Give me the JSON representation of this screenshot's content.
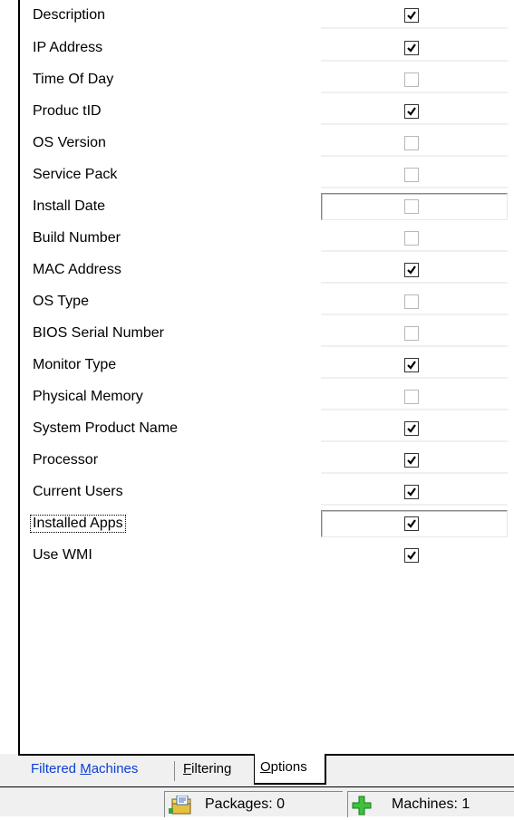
{
  "options": {
    "rows": [
      {
        "label": "Description",
        "checked": true
      },
      {
        "label": "IP Address",
        "checked": true
      },
      {
        "label": "Time Of Day",
        "checked": false
      },
      {
        "label": "Produc tID",
        "checked": true
      },
      {
        "label": "OS Version",
        "checked": false
      },
      {
        "label": "Service Pack",
        "checked": false
      },
      {
        "label": "Install Date",
        "checked": false
      },
      {
        "label": "Build Number",
        "checked": false
      },
      {
        "label": "MAC Address",
        "checked": true
      },
      {
        "label": "OS Type",
        "checked": false
      },
      {
        "label": "BIOS Serial Number",
        "checked": false
      },
      {
        "label": "Monitor Type",
        "checked": true
      },
      {
        "label": "Physical Memory",
        "checked": false
      },
      {
        "label": "System Product Name",
        "checked": true
      },
      {
        "label": "Processor",
        "checked": true
      },
      {
        "label": "Current Users",
        "checked": true
      },
      {
        "label": "Installed Apps",
        "checked": true
      },
      {
        "label": "Use WMI",
        "checked": true
      }
    ]
  },
  "tabs": {
    "filtered_prefix": "Filtered ",
    "filtered_underlined": "M",
    "filtered_suffix": "achines",
    "filtering_underlined": "F",
    "filtering_suffix": "iltering",
    "options_underlined": "O",
    "options_suffix": "ptions"
  },
  "statusbar": {
    "packages_label": "Packages: 0",
    "machines_label": "Machines:  1"
  },
  "colors": {
    "link_blue": "#0b3fd6",
    "checkmark": "#000000"
  }
}
